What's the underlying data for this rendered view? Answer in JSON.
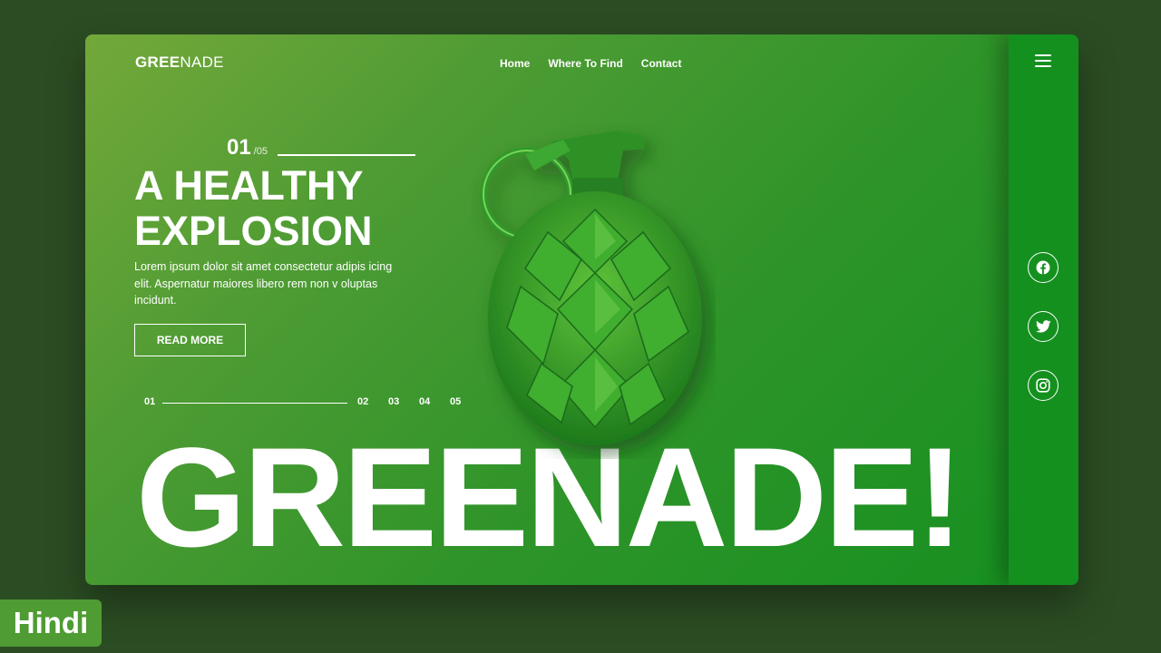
{
  "brand": {
    "logo_bold": "GREE",
    "logo_light": "NADE"
  },
  "nav": {
    "items": [
      "Home",
      "Where To Find",
      "Contact"
    ]
  },
  "slide": {
    "current": "01",
    "total": "/05"
  },
  "hero": {
    "headline_line1": "A HEALTHY",
    "headline_line2": "EXPLOSION",
    "description": "Lorem ipsum dolor sit amet consectetur adipis icing elit. Aspernatur maiores libero rem non v oluptas incidunt.",
    "cta_label": "READ MORE"
  },
  "pagination": {
    "active": "01",
    "others": [
      "02",
      "03",
      "04",
      "05"
    ]
  },
  "big_word": "GREENADE!",
  "sidebar": {
    "social": [
      "facebook-icon",
      "twitter-icon",
      "instagram-icon"
    ]
  },
  "badge": {
    "label": "Hindi"
  },
  "colors": {
    "page_background": "#2b4d23",
    "card_gradient_start": "#73a83a",
    "card_gradient_end": "#159020",
    "sidebar": "#14901f",
    "text": "#ffffff",
    "badge": "#4e9c33"
  }
}
